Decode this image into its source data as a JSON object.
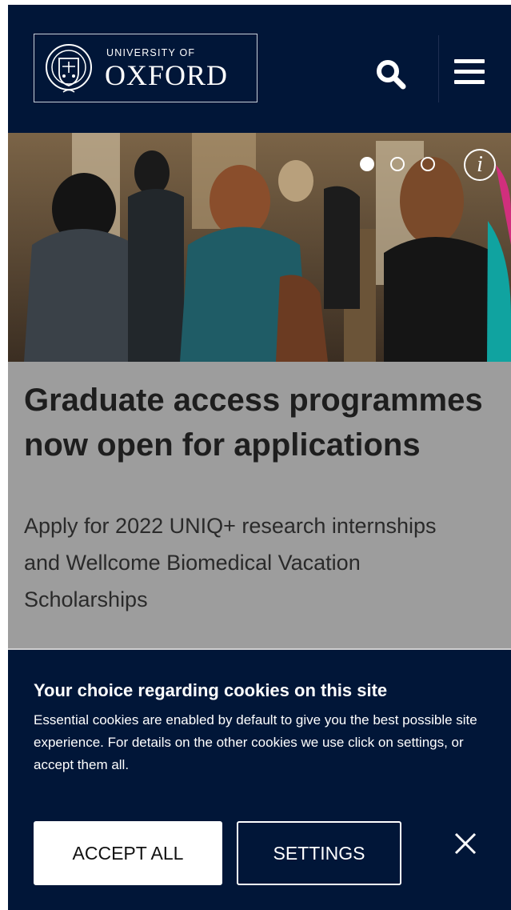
{
  "header": {
    "logo_small": "UNIVERSITY OF",
    "logo_big": "OXFORD",
    "search_icon": "search-icon",
    "menu_icon": "hamburger-menu-icon",
    "background": "#011638"
  },
  "carousel": {
    "slides": 3,
    "active": 1,
    "info_label": "i"
  },
  "caption": {
    "title": "Graduate access programmes now open for applications",
    "text": "Apply for 2022 UNIQ+ research internships and Wellcome Biomedical Vacation Scholarships"
  },
  "cookie_banner": {
    "heading": "Your choice regarding cookies on this site",
    "body": "Essential cookies are enabled by default to give you the best possible site experience. For details on the other cookies we use click on settings, or accept them all.",
    "accept_label": "ACCEPT ALL",
    "settings_label": "SETTINGS",
    "close_icon": "close-icon"
  }
}
